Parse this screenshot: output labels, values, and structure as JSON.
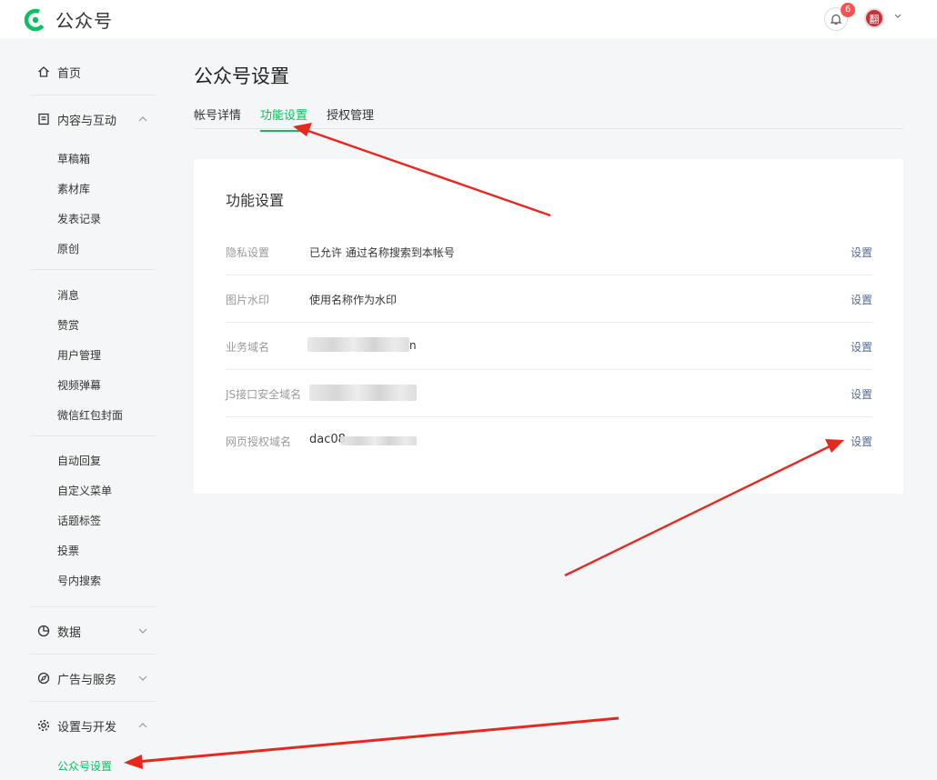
{
  "app": {
    "name": "公众号"
  },
  "header": {
    "notification_count": "6",
    "avatar_text": "翻"
  },
  "sidebar": {
    "home": "首页",
    "content": "内容与互动",
    "content_items": [
      "草稿箱",
      "素材库",
      "发表记录",
      "原创"
    ],
    "interact_items": [
      "消息",
      "赞赏",
      "用户管理",
      "视频弹幕",
      "微信红包封面"
    ],
    "auto_items": [
      "自动回复",
      "自定义菜单",
      "话题标签",
      "投票",
      "号内搜索"
    ],
    "data": "数据",
    "ads": "广告与服务",
    "settings": "设置与开发",
    "settings_items": [
      "公众号设置"
    ]
  },
  "main": {
    "title": "公众号设置",
    "tabs": [
      "帐号详情",
      "功能设置",
      "授权管理"
    ],
    "card_title": "功能设置",
    "rows": [
      {
        "label": "隐私设置",
        "value": "已允许 通过名称搜索到本帐号",
        "action": "设置"
      },
      {
        "label": "图片水印",
        "value": "使用名称作为水印",
        "action": "设置"
      },
      {
        "label": "业务域名",
        "value": "n",
        "action": "设置"
      },
      {
        "label": "JS接口安全域名",
        "value": "",
        "action": "设置"
      },
      {
        "label": "网页授权域名",
        "value": "dac08",
        "action": "设置"
      }
    ]
  },
  "colors": {
    "accent": "#07c160",
    "link": "#576b95",
    "annotation": "#e8271f",
    "badge": "#fa5151"
  }
}
